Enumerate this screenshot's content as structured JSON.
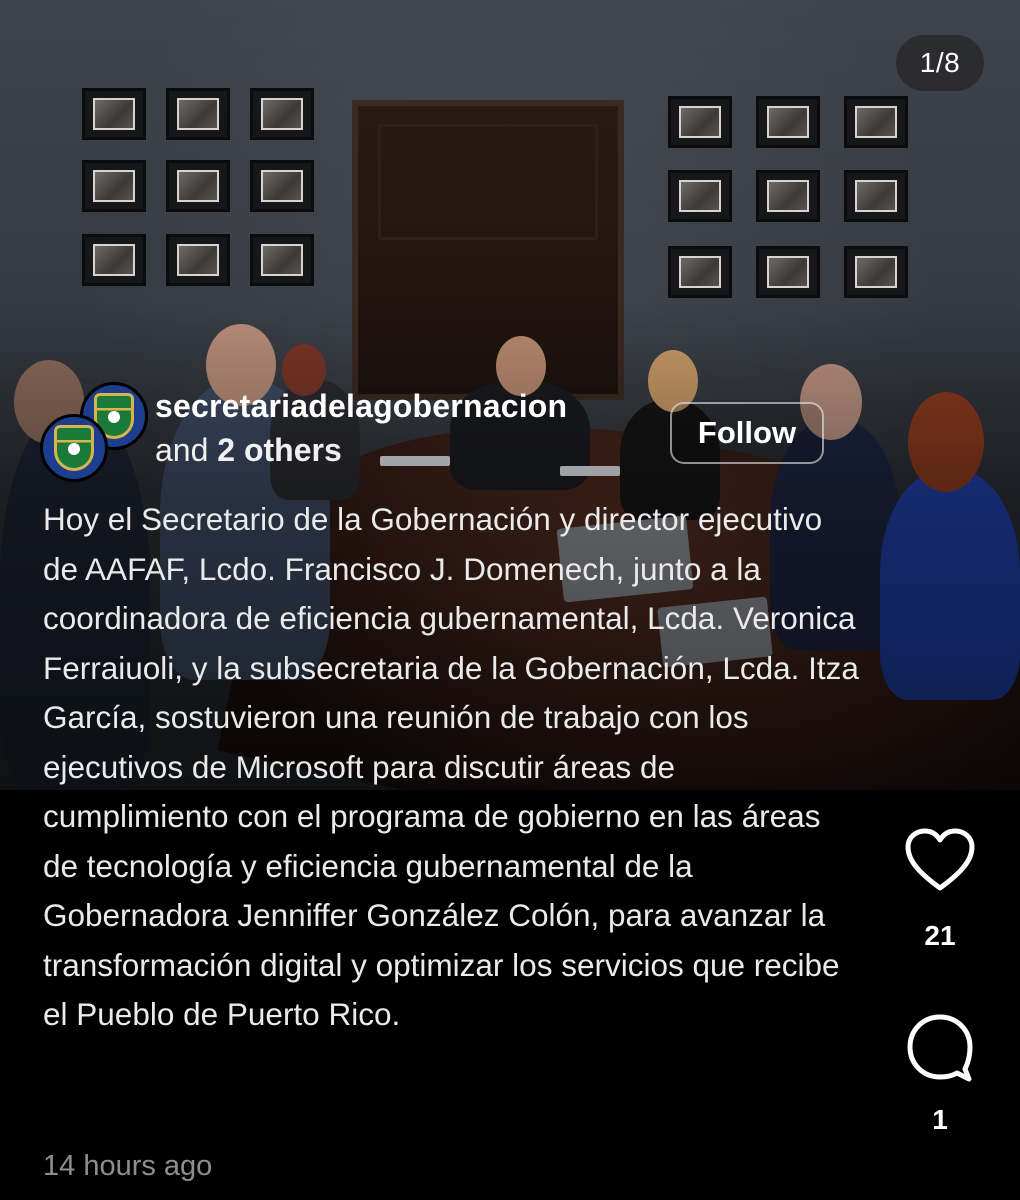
{
  "carousel": {
    "position": "1/8"
  },
  "post": {
    "owner": "secretariadelagobernacion",
    "coauthors_prefix": "and ",
    "coauthors_bold": "2 others",
    "follow_label": "Follow",
    "caption": "Hoy el Secretario de la Gobernación y director ejecutivo de AAFAF, Lcdo. Francisco J. Domenech, junto a la coordinadora de eficiencia gubernamental, Lcda. Veronica Ferraiuoli, y la subsecretaria de la Gobernación, Lcda. Itza García, sostuvieron una reunión de trabajo con los ejecutivos de Microsoft para discutir áreas de cumplimiento con el programa de gobierno en las áreas de tecnología y eficiencia gubernamental de la Gobernadora Jenniffer González Colón, para avanzar la transformación digital y optimizar los servicios que recibe el Pueblo de Puerto Rico.",
    "timestamp": "14 hours ago"
  },
  "actions": {
    "like_icon": "heart-icon",
    "like_count": "21",
    "comment_icon": "comment-bubble-icon",
    "comment_count": "1"
  },
  "colors": {
    "background": "#000000",
    "text": "#ffffff",
    "muted": "#8e8e8e",
    "avatar": "#1d3d8f"
  }
}
